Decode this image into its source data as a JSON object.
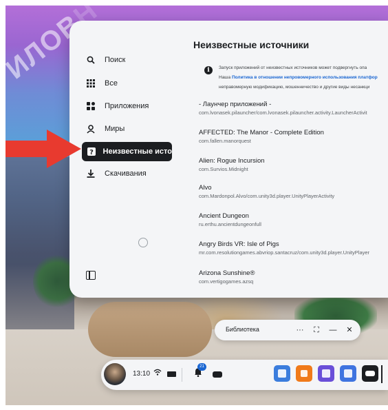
{
  "watermark": {
    "visible_text": "ИЛОВ",
    "trailing_text": "Н"
  },
  "sidebar": {
    "items": [
      {
        "label": "Поиск",
        "icon": "search-icon"
      },
      {
        "label": "Все",
        "icon": "grid-icon"
      },
      {
        "label": "Приложения",
        "icon": "apps-icon"
      },
      {
        "label": "Миры",
        "icon": "worlds-icon"
      },
      {
        "label": "Неизвестные источн..",
        "icon": "unknown-source-icon",
        "active": true
      },
      {
        "label": "Скачивания",
        "icon": "download-icon"
      }
    ]
  },
  "main": {
    "title": "Неизвестные источники",
    "notice": {
      "line1": "Запуск приложений от неизвестных источников может подвергнуть опа",
      "line2_prefix": "Наша ",
      "line2_link": "Политика в отношении непровомерного использования платфор",
      "line3": "неправомерную модификацию, мошенничество и другие виды несанкци"
    },
    "apps": [
      {
        "name": "- Лаунчер приложений -",
        "package": "com.lvonasek.pilauncher/com.lvonasek.pilauncher.activity.LauncherActivit"
      },
      {
        "name": "AFFECTED: The Manor - Complete Edition",
        "package": "com.fallen.manorquest"
      },
      {
        "name": "Alien: Rogue Incursion",
        "package": "com.Survios.Midnight"
      },
      {
        "name": "Alvo",
        "package": "com.Mardonpol.Alvo/com.unity3d.player.UnityPlayerActivity"
      },
      {
        "name": "Ancient Dungeon",
        "package": "ru.erthu.ancientdungeonfull"
      },
      {
        "name": "Angry Birds VR: Isle of Pigs",
        "package": "mr.com.resolutiongames.abvriop.santacruz/com.unity3d.player.UnityPlayer"
      },
      {
        "name": "Arizona Sunshine®",
        "package": "com.vertigogames.azsq"
      }
    ]
  },
  "library_bar": {
    "title": "Библиотека",
    "more": "···",
    "expand": "⛶",
    "minimize": "—",
    "close": "✕"
  },
  "taskbar": {
    "time": "13:10",
    "notification_count": "21",
    "pinned_apps": [
      {
        "icon": "browser-icon",
        "color": "#3b7ddd"
      },
      {
        "icon": "store-icon",
        "color": "#f07a1a"
      },
      {
        "icon": "chat-icon",
        "color": "#6a4fd8"
      },
      {
        "icon": "explore-icon",
        "color": "#3f74e0"
      },
      {
        "icon": "vr-app-icon",
        "color": "#1c1e21"
      }
    ]
  },
  "colors": {
    "panel": "#f4f5f7",
    "active_nav": "#1c1e21",
    "link": "#1a66d2",
    "arrow": "#e83a2f"
  }
}
